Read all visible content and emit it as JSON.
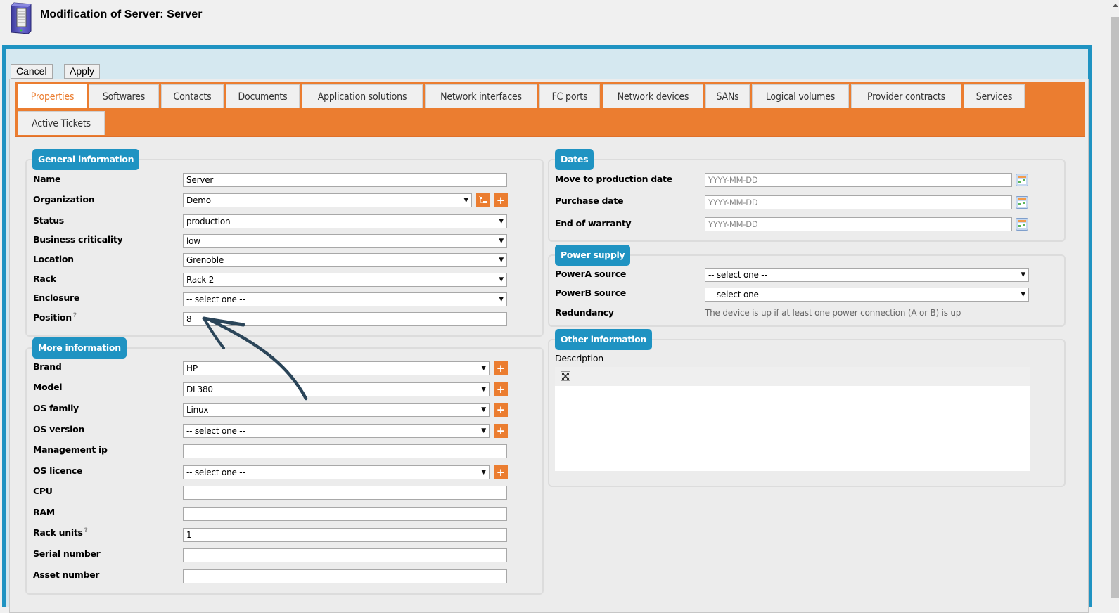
{
  "header": {
    "title": "Modification of Server: Server",
    "icon": "server-icon"
  },
  "toolbar": {
    "cancel_label": "Cancel",
    "apply_label": "Apply"
  },
  "tabs": [
    {
      "label": "Properties",
      "active": true
    },
    {
      "label": "Softwares"
    },
    {
      "label": "Contacts"
    },
    {
      "label": "Documents"
    },
    {
      "label": "Application solutions"
    },
    {
      "label": "Network interfaces"
    },
    {
      "label": "FC ports"
    },
    {
      "label": "Network devices"
    },
    {
      "label": "SANs"
    },
    {
      "label": "Logical volumes"
    },
    {
      "label": "Provider contracts"
    },
    {
      "label": "Services"
    },
    {
      "label": "Active Tickets"
    }
  ],
  "general": {
    "legend": "General information",
    "fields": {
      "name": {
        "label": "Name",
        "value": "Server"
      },
      "organization": {
        "label": "Organization",
        "value": "Demo"
      },
      "status": {
        "label": "Status",
        "value": "production"
      },
      "business_criticality": {
        "label": "Business criticality",
        "value": "low"
      },
      "location": {
        "label": "Location",
        "value": "Grenoble"
      },
      "rack": {
        "label": "Rack",
        "value": "Rack 2"
      },
      "enclosure": {
        "label": "Enclosure",
        "value": "-- select one --"
      },
      "position": {
        "label": "Position",
        "hint": "?",
        "value": "8"
      }
    }
  },
  "more": {
    "legend": "More information",
    "fields": {
      "brand": {
        "label": "Brand",
        "value": "HP"
      },
      "model": {
        "label": "Model",
        "value": "DL380"
      },
      "os_family": {
        "label": "OS family",
        "value": "Linux"
      },
      "os_version": {
        "label": "OS version",
        "value": "-- select one --"
      },
      "management_ip": {
        "label": "Management ip",
        "value": ""
      },
      "os_licence": {
        "label": "OS licence",
        "value": "-- select one --"
      },
      "cpu": {
        "label": "CPU",
        "value": ""
      },
      "ram": {
        "label": "RAM",
        "value": ""
      },
      "rack_units": {
        "label": "Rack units",
        "hint": "?",
        "value": "1"
      },
      "serial_number": {
        "label": "Serial number",
        "value": ""
      },
      "asset_number": {
        "label": "Asset number",
        "value": ""
      }
    }
  },
  "dates": {
    "legend": "Dates",
    "fields": {
      "move_to_production": {
        "label": "Move to production date",
        "placeholder": "YYYY-MM-DD"
      },
      "purchase_date": {
        "label": "Purchase date",
        "placeholder": "YYYY-MM-DD"
      },
      "end_of_warranty": {
        "label": "End of warranty",
        "placeholder": "YYYY-MM-DD"
      }
    }
  },
  "power": {
    "legend": "Power supply",
    "fields": {
      "powera": {
        "label": "PowerA source",
        "value": "-- select one --"
      },
      "powerb": {
        "label": "PowerB source",
        "value": "-- select one --"
      },
      "redundancy": {
        "label": "Redundancy",
        "value": "The device is up if at least one power connection (A or B) is up"
      }
    }
  },
  "other": {
    "legend": "Other information",
    "fields": {
      "description": {
        "label": "Description",
        "value": ""
      }
    }
  },
  "colors": {
    "accent_orange": "#eb7d30",
    "accent_blue": "#1f93c2",
    "annotation_arrow": "#2b4559"
  }
}
